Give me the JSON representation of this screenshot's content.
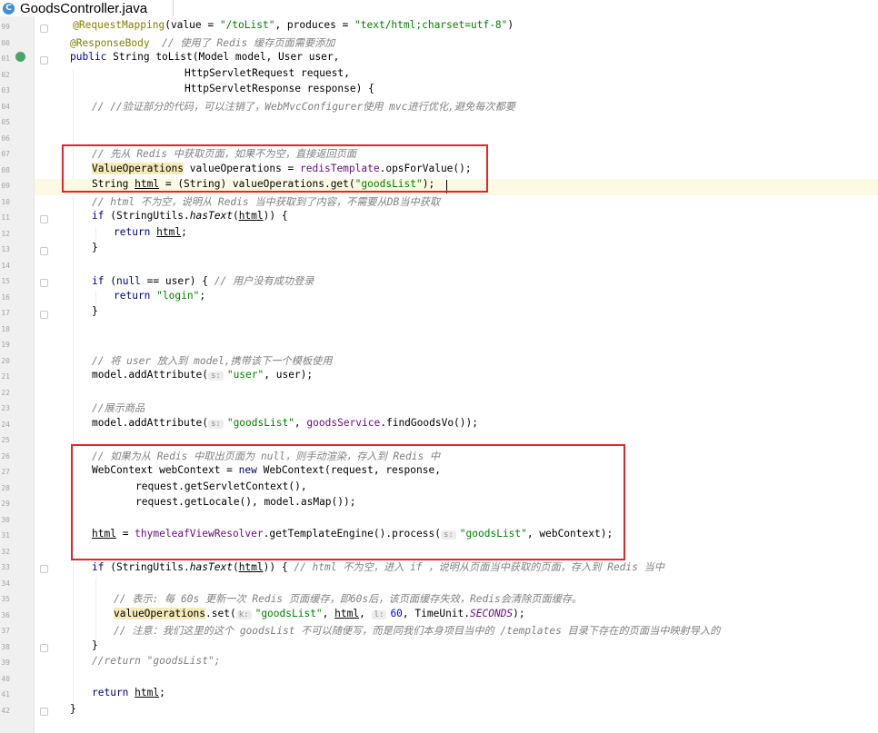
{
  "tab": {
    "icon_letter": "C",
    "filename": "GoodsController.java"
  },
  "gutter": {
    "line_numbers": [
      "99",
      "00",
      "01",
      "02",
      "03",
      "04",
      "05",
      "06",
      "07",
      "08",
      "09",
      "10",
      "11",
      "12",
      "13",
      "14",
      "15",
      "16",
      "17",
      "18",
      "19",
      "20",
      "21",
      "22",
      "23",
      "24",
      "25",
      "26",
      "27",
      "28",
      "29",
      "30",
      "31",
      "32",
      "33",
      "34",
      "35",
      "36",
      "37",
      "38",
      "39",
      "40",
      "41",
      "42"
    ]
  },
  "code": {
    "l0_an": "@RequestMapping",
    "l0_a": "(value = ",
    "l0_s1": "\"/toList\"",
    "l0_b": ", produces = ",
    "l0_s2": "\"text/html;charset=utf-8\"",
    "l0_c": ")",
    "l1_an": "@ResponseBody",
    "l1_c": "  // 使用了 Redis 缓存页面需要添加",
    "l2_kw": "public",
    "l2_a": " String ",
    "l2_m": "toList",
    "l2_b": "(Model model, User user,",
    "l3": "HttpServletRequest request,",
    "l4": "HttpServletResponse response) {",
    "l5_c": "// //验证部分的代码，可以注销了，WebMvcConfigurer使用 mvc进行优化,避免每次都要",
    "l8_c": "// 先从 Redis 中获取页面，如果不为空，直接返回页面",
    "l9_h": "ValueOperations",
    "l9_a": " valueOperations = ",
    "l9_f": "redisTemplate",
    "l9_b": ".opsForValue();",
    "l10_a": "String ",
    "l10_u": "html",
    "l10_b": " = (String) valueOperations.get(",
    "l10_s": "\"goodsList\"",
    "l10_c": ");",
    "l11_c": "// html 不为空，说明从 Redis 当中获取到了内容，不需要从DB当中获取",
    "l12_kw": "if",
    "l12_a": " (StringUtils.",
    "l12_i": "hasText",
    "l12_b": "(",
    "l12_u": "html",
    "l12_c": ")) {",
    "l13_kw": "return",
    "l13_sp": " ",
    "l13_u": "html",
    "l13_semi": ";",
    "close_brace": "}",
    "l16_kw": "if",
    "l16_a": " (",
    "l16_kw2": "null",
    "l16_b": " == user) { ",
    "l16_c": "// 用户没有成功登录",
    "l17_kw": "return",
    "l17_sp": " ",
    "l17_s": "\"login\"",
    "l17_semi": ";",
    "l21_c": "// 将 user 放入到 model,携带该下一个模板使用",
    "l22_a": "model.addAttribute(",
    "l22_h": "s:",
    "l22_s": "\"user\"",
    "l22_b": ", user);",
    "l24_c": "//展示商品",
    "l25_a": "model.addAttribute(",
    "l25_h": "s:",
    "l25_s": "\"goodsList\"",
    "l25_b": ", ",
    "l25_f": "goodsService",
    "l25_c": ".findGoodsVo());",
    "l27_c": "// 如果为从 Redis 中取出页面为 null，则手动渲染，存入到 Redis 中",
    "l28_a": "WebContext webContext = ",
    "l28_kw": "new",
    "l28_b": " WebContext(request, response,",
    "l29": "request.getServletContext(),",
    "l30": "request.getLocale(), model.asMap());",
    "l32_u": "html",
    "l32_a": " = ",
    "l32_f": "thymeleafViewResolver",
    "l32_b": ".getTemplateEngine().process(",
    "l32_h": "s:",
    "l32_s": "\"goodsList\"",
    "l32_c": ", webContext);",
    "l34_kw": "if",
    "l34_a": " (StringUtils.",
    "l34_i": "hasText",
    "l34_b": "(",
    "l34_u": "html",
    "l34_c": ")) { ",
    "l34_cm": "// html 不为空，进入 if ，说明从页面当中获取的页面，存入到 Redis 当中",
    "l36_c": "// 表示: 每 60s 更新一次 Redis 页面缓存，即60s后，该页面缓存失效，Redis会清除页面缓存。",
    "l37_h": "valueOperations",
    "l37_a": ".set(",
    "l37_h1": "k:",
    "l37_s": "\"goodsList\"",
    "l37_b": ", ",
    "l37_u": "html",
    "l37_c": ", ",
    "l37_h2": "l:",
    "l37_n": "60",
    "l37_d": ", TimeUnit.",
    "l37_e": "SECONDS",
    "l37_f": ");",
    "l38_c": "// 注意：我们这里的这个 goodsList 不可以随便写，而是同我们本身项目当中的 /templates 目录下存在的页面当中映射导入的",
    "l40_c": "//return \"goodsList\";",
    "l42_kw": "return",
    "l42_sp": " ",
    "l42_u": "html",
    "l42_semi": ";"
  }
}
